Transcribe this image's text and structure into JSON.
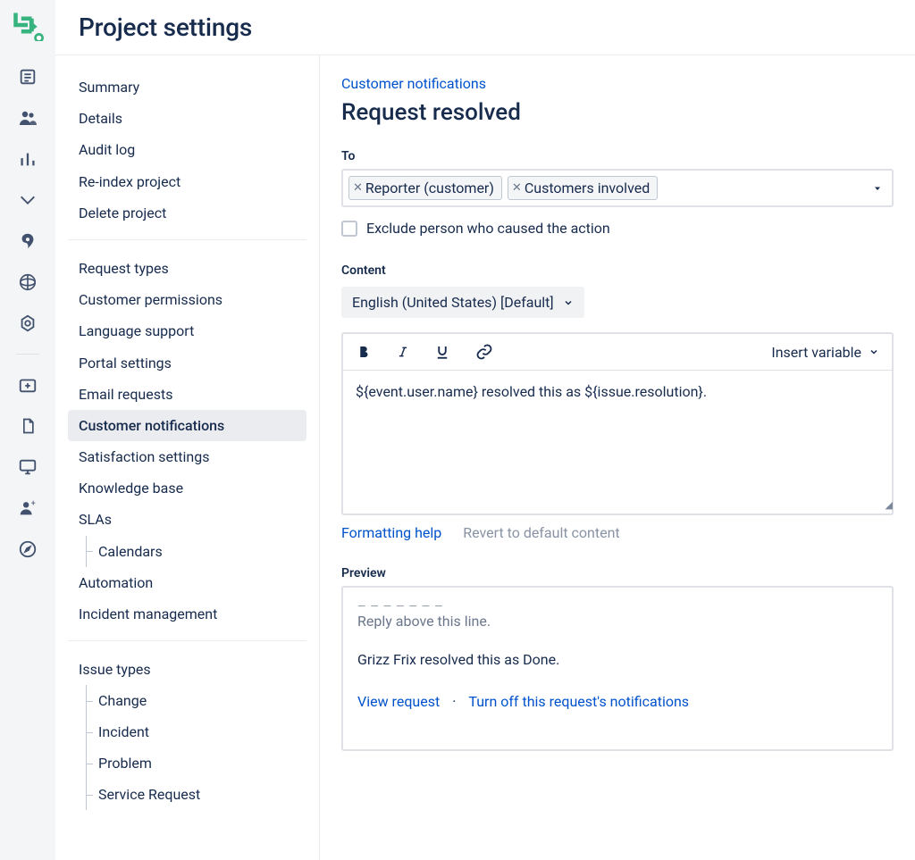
{
  "header": {
    "title": "Project settings"
  },
  "sidebar": {
    "group1": [
      "Summary",
      "Details",
      "Audit log",
      "Re-index project",
      "Delete project"
    ],
    "group2": [
      "Request types",
      "Customer permissions",
      "Language support",
      "Portal settings",
      "Email requests",
      "Customer notifications",
      "Satisfaction settings",
      "Knowledge base",
      "SLAs",
      "Automation",
      "Incident management"
    ],
    "group2_sub_after": {
      "SLAs": [
        "Calendars"
      ]
    },
    "group2_active": "Customer notifications",
    "group3_label": "Issue types",
    "group3_items": [
      "Change",
      "Incident",
      "Problem",
      "Service Request"
    ]
  },
  "pane": {
    "breadcrumb": "Customer notifications",
    "title": "Request resolved",
    "to_label": "To",
    "chips": [
      "Reporter (customer)",
      "Customers involved"
    ],
    "exclude_label": "Exclude person who caused the action",
    "content_label": "Content",
    "language_select": "English (United States) [Default]",
    "insert_variable_label": "Insert variable",
    "editor_text": "${event.user.name} resolved this as ${issue.resolution}.",
    "formatting_help": "Formatting help",
    "revert_link": "Revert to default content",
    "preview_label": "Preview",
    "preview_hint": "Reply above this line.",
    "preview_line": "Grizz Frix resolved this as Done.",
    "preview_action1": "View request",
    "preview_action2": "Turn off this request's notifications"
  }
}
